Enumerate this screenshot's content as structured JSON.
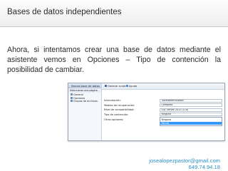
{
  "slide": {
    "title": "Bases de datos independientes",
    "body": "Ahora, si intentamos crear una base de datos mediante el asistente vemos en Opciones – Tipo de contención la posibilidad de cambiar."
  },
  "dialog": {
    "window_title": "Nueva base de datos",
    "select_page_label": "Seleccionar una página",
    "pages": [
      "General",
      "Opciones",
      "Grupos de archivos"
    ],
    "toolbar": {
      "script_label": "Generar script",
      "help_label": "Ayuda"
    },
    "properties": [
      {
        "label": "Intercalación:",
        "value": "<predeterminado>"
      },
      {
        "label": "Modelo de recuperación:",
        "value": "Completo"
      },
      {
        "label": "Nivel de compatibilidad:",
        "value": "SQL Server 2012 (110)"
      },
      {
        "label": "Tipo de contención:",
        "value": "Ninguno"
      },
      {
        "label": "Otras opciones:",
        "value": ""
      }
    ],
    "dropdown_options": [
      "Ninguno",
      "Parcial"
    ],
    "dropdown_selected": "Parcial"
  },
  "footer": {
    "email": "josealopezpastor@gmail.com",
    "number": "649.74.94.18"
  },
  "colors": {
    "footer_text": "#2d8fc4",
    "selection": "#3399ff"
  }
}
